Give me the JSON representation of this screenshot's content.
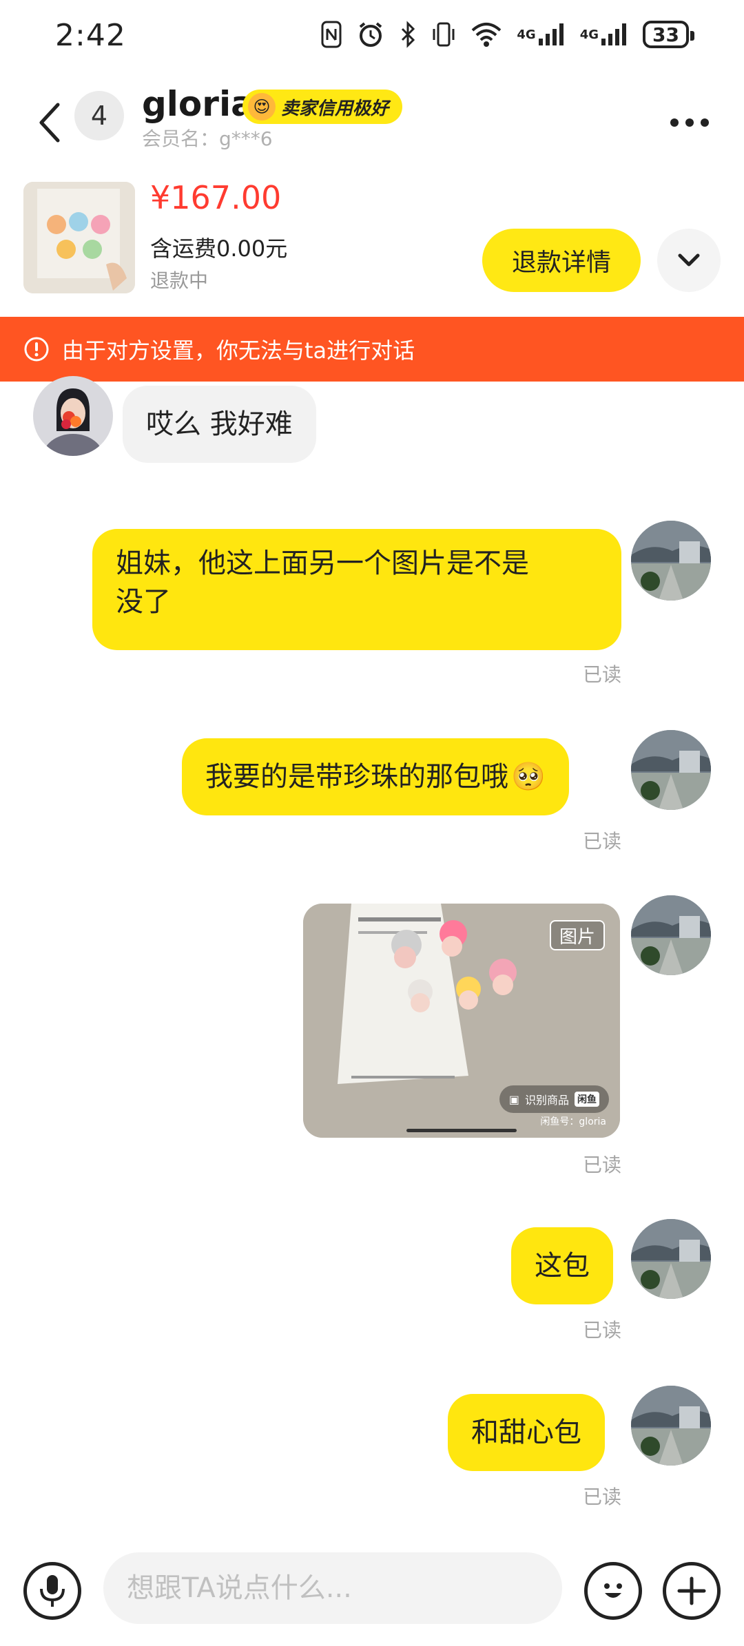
{
  "status_bar": {
    "time": "2:42",
    "battery": "33",
    "network_1": "4G",
    "network_2": "4G"
  },
  "header": {
    "unread_count": "4",
    "nickname": "gloria",
    "credit_badge": "卖家信用极好",
    "member_name": "会员名：g***6"
  },
  "product": {
    "price": "¥167.00",
    "shipping": "含运费0.00元",
    "status": "退款中",
    "refund_button": "退款详情"
  },
  "warning": {
    "text": "由于对方设置，你无法与ta进行对话"
  },
  "messages": [
    {
      "from": "seller",
      "text": "哎么 我好难"
    },
    {
      "from": "me",
      "line1": "姐妹，他这上面另一个图片是不是",
      "line2": "没了",
      "read": "已读"
    },
    {
      "from": "me",
      "text": "我要的是带珍珠的那包哦",
      "emoji": "🥺",
      "read": "已读"
    },
    {
      "from": "me",
      "type": "image",
      "tag": "图片",
      "recognize": "识别商品",
      "mark": "闲鱼",
      "watermark": "闲鱼号：gloria",
      "read": "已读"
    },
    {
      "from": "me",
      "text": "这包",
      "read": "已读"
    },
    {
      "from": "me",
      "text": "和甜心包",
      "read": "已读"
    }
  ],
  "input_bar": {
    "placeholder": "想跟TA说点什么..."
  },
  "colors": {
    "brand_yellow": "#ffe60f",
    "warning_orange": "#ff5522",
    "price_red": "#ff3b30"
  }
}
